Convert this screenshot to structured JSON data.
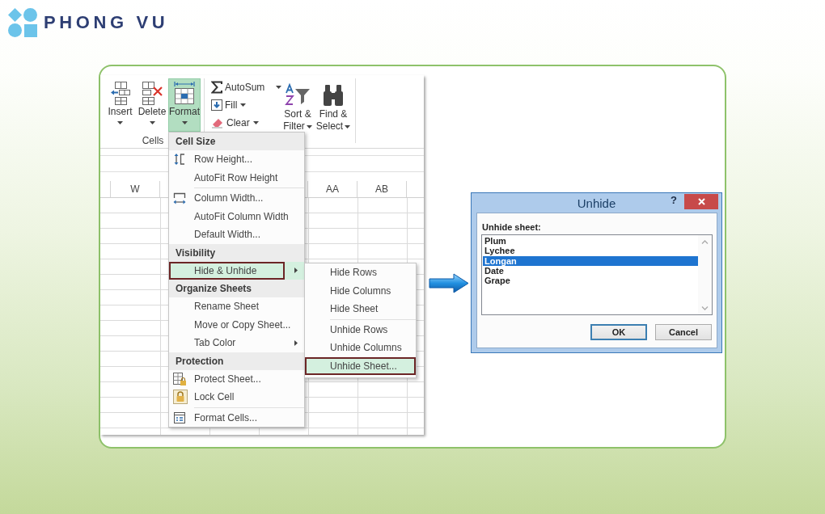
{
  "logo": {
    "name": "PHONG VU"
  },
  "excel": {
    "ribbon": {
      "cells_group": {
        "label": "Cells",
        "buttons": [
          {
            "label": "Insert",
            "selected": false
          },
          {
            "label": "Delete",
            "selected": false
          },
          {
            "label": "Format",
            "selected": true
          }
        ]
      },
      "editing_group": {
        "small_buttons": [
          {
            "label": "AutoSum"
          },
          {
            "label": "Fill"
          },
          {
            "label": "Clear"
          }
        ],
        "large_buttons": [
          {
            "label": "Sort & Filter"
          },
          {
            "label": "Find & Select"
          }
        ]
      }
    },
    "sheet": {
      "column_headers": [
        "W",
        "AA",
        "AB"
      ]
    },
    "format_menu": {
      "items": [
        {
          "kind": "header",
          "label": "Cell Size"
        },
        {
          "kind": "item",
          "label": "Row Height...",
          "selected": false,
          "has_submenu": false
        },
        {
          "kind": "item",
          "label": "AutoFit Row Height",
          "selected": false,
          "has_submenu": false
        },
        {
          "kind": "separator"
        },
        {
          "kind": "item",
          "label": "Column Width...",
          "selected": false,
          "has_submenu": false
        },
        {
          "kind": "item",
          "label": "AutoFit Column Width",
          "selected": false,
          "has_submenu": false
        },
        {
          "kind": "item",
          "label": "Default Width...",
          "selected": false,
          "has_submenu": false
        },
        {
          "kind": "header",
          "label": "Visibility"
        },
        {
          "kind": "item",
          "label": "Hide & Unhide",
          "selected": true,
          "has_submenu": true
        },
        {
          "kind": "header",
          "label": "Organize Sheets"
        },
        {
          "kind": "item",
          "label": "Rename Sheet",
          "selected": false,
          "has_submenu": false
        },
        {
          "kind": "item",
          "label": "Move or Copy Sheet...",
          "selected": false,
          "has_submenu": false
        },
        {
          "kind": "item",
          "label": "Tab Color",
          "selected": false,
          "has_submenu": true
        },
        {
          "kind": "header",
          "label": "Protection"
        },
        {
          "kind": "item",
          "label": "Protect Sheet...",
          "selected": false,
          "has_submenu": false
        },
        {
          "kind": "item",
          "label": "Lock Cell",
          "selected": false,
          "has_submenu": false
        },
        {
          "kind": "separator"
        },
        {
          "kind": "item",
          "label": "Format Cells...",
          "selected": false,
          "has_submenu": false
        }
      ]
    },
    "hide_unhide_submenu": {
      "items": [
        {
          "kind": "item",
          "label": "Hide Rows",
          "selected": false
        },
        {
          "kind": "item",
          "label": "Hide Columns",
          "selected": false
        },
        {
          "kind": "item",
          "label": "Hide Sheet",
          "selected": false
        },
        {
          "kind": "separator"
        },
        {
          "kind": "item",
          "label": "Unhide Rows",
          "selected": false
        },
        {
          "kind": "item",
          "label": "Unhide Columns",
          "selected": false
        },
        {
          "kind": "item",
          "label": "Unhide Sheet...",
          "selected": true
        }
      ]
    }
  },
  "unhide_dialog": {
    "title": "Unhide",
    "help": "?",
    "list_label": "Unhide sheet:",
    "sheets": [
      {
        "name": "Plum",
        "selected": false
      },
      {
        "name": "Lychee",
        "selected": false
      },
      {
        "name": "Longan",
        "selected": true
      },
      {
        "name": "Date",
        "selected": false
      },
      {
        "name": "Grape",
        "selected": false
      }
    ],
    "buttons": [
      {
        "label": "OK",
        "default": true
      },
      {
        "label": "Cancel",
        "default": false
      }
    ]
  }
}
